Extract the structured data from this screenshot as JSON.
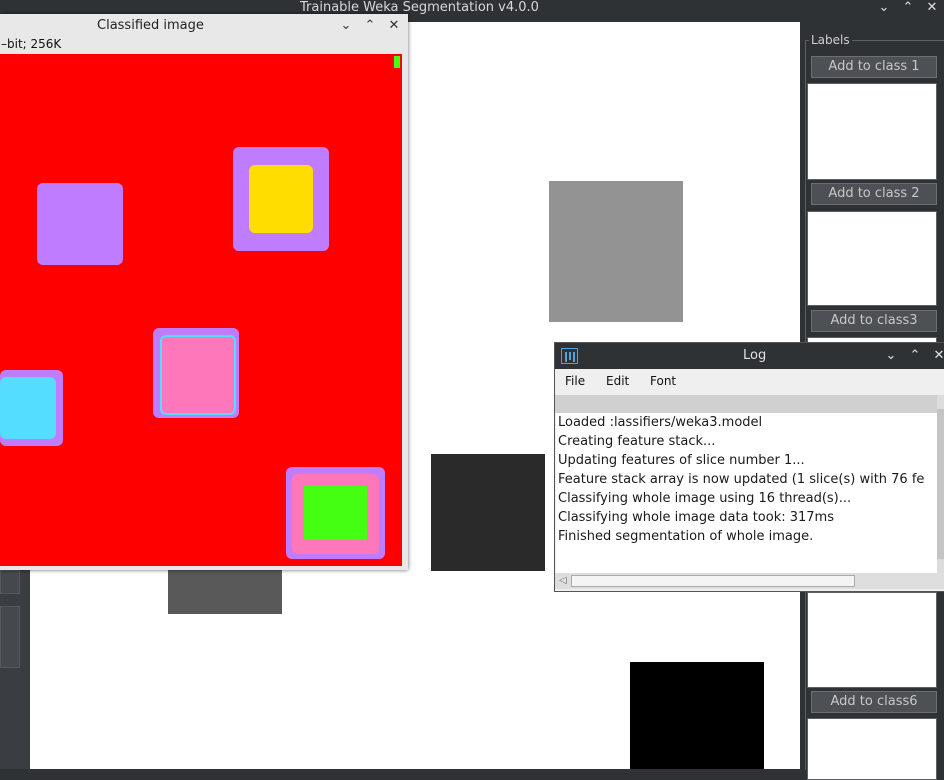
{
  "main_window": {
    "title": "Trainable Weka Segmentation v4.0.0",
    "controls": {
      "minimize": "⌄",
      "maximize": "⌃",
      "close": "✕"
    }
  },
  "labels_panel": {
    "title": "Labels",
    "buttons": [
      "Add to class 1",
      "Add to class 2",
      "Add to class3",
      "Add to class6"
    ]
  },
  "canvas_squares": [
    {
      "name": "gray-square",
      "color": "#939393"
    },
    {
      "name": "dark-square",
      "color": "#2a2a2a"
    },
    {
      "name": "dim-square",
      "color": "#595959"
    },
    {
      "name": "black-square",
      "color": "#000000"
    }
  ],
  "classified_window": {
    "title": "Classified image",
    "info": "–bit; 256K",
    "colors": {
      "background": "#ff0000",
      "purple": "#c07cff",
      "yellow": "#ffdd00",
      "pink": "#ff77bb",
      "cyan": "#55ddff",
      "green": "#44ff11"
    }
  },
  "log_window": {
    "title": "Log",
    "menu": [
      "File",
      "Edit",
      "Font"
    ],
    "lines": [
      "Loaded                         :lassifiers/weka3.model",
      "Creating feature stack...",
      "Updating features of slice number 1...",
      "Feature stack array is now updated (1 slice(s) with 76 fe",
      "Classifying whole image using 16 thread(s)...",
      "Classifying whole image data took: 317ms",
      "Finished segmentation of whole image."
    ]
  }
}
